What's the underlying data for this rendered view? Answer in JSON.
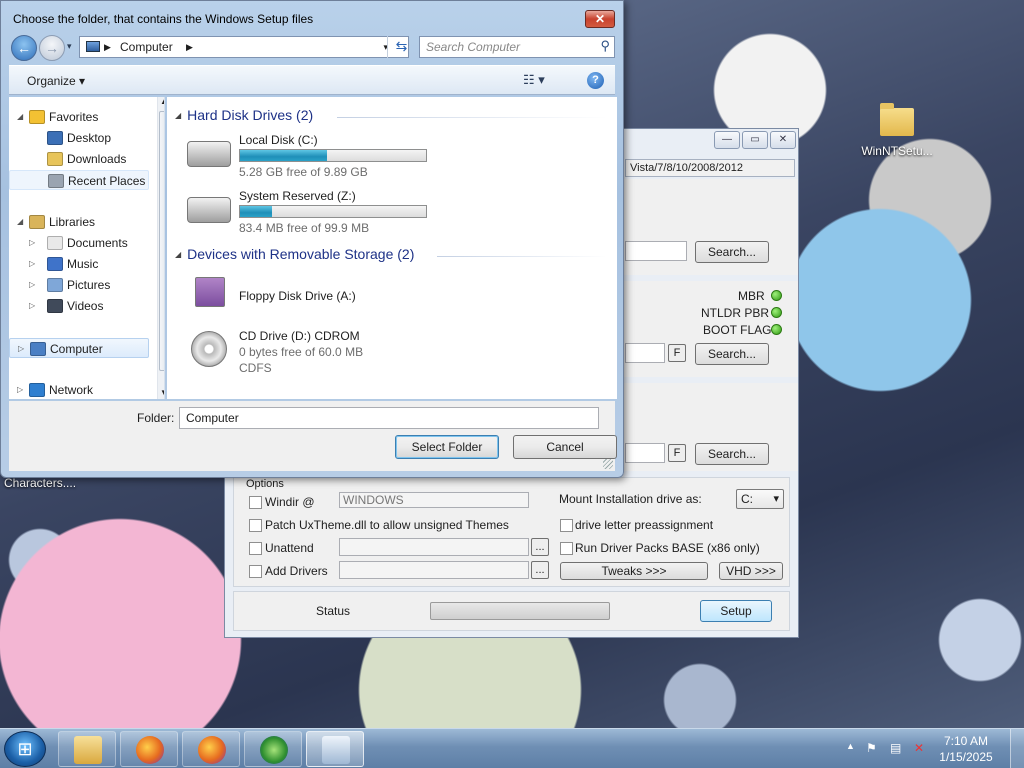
{
  "desktop": {
    "icon_label": "WinNTSetu...",
    "caption": "Characters...."
  },
  "app": {
    "tab_label": "Vista/7/8/10/2008/2012",
    "search_label": "Search...",
    "status_items": [
      {
        "label": "MBR",
        "color": "#3fb91c"
      },
      {
        "label": "NTLDR PBR",
        "color": "#3fb91c"
      },
      {
        "label": "BOOT FLAG",
        "color": "#3fb91c"
      }
    ],
    "f_label": "F",
    "options": {
      "group_label": "Options",
      "windir_label": "Windir @",
      "windir_value": "WINDOWS",
      "patch_label": "Patch UxTheme.dll to allow unsigned Themes",
      "unattend_label": "Unattend",
      "add_drivers_label": "Add Drivers",
      "browse_label": "...",
      "mount_label": "Mount Installation drive as:",
      "mount_value": "C:",
      "preassign_label": "drive letter preassignment",
      "driverpacks_label": "Run Driver Packs BASE (x86 only)",
      "tweaks_label": "Tweaks >>>",
      "vhd_label": "VHD >>>"
    },
    "status_label": "Status",
    "setup_label": "Setup",
    "window_buttons": {
      "min": "—",
      "max": "▭",
      "close": "✕"
    }
  },
  "dialog": {
    "title": "Choose the folder, that contains the Windows Setup files",
    "close": "✕",
    "address": "Computer",
    "search_placeholder": "Search Computer",
    "organize": "Organize ▾",
    "help": "?",
    "nav": [
      {
        "label": "Favorites",
        "icon": "star-icon",
        "color": "#f3c133",
        "indent": 0,
        "expander": "◢"
      },
      {
        "label": "Desktop",
        "icon": "desktop-icon",
        "color": "#3b6fb6",
        "indent": 1,
        "expander": ""
      },
      {
        "label": "Downloads",
        "icon": "downloads-folder-icon",
        "color": "#e7c45a",
        "indent": 1,
        "expander": ""
      },
      {
        "label": "Recent Places",
        "icon": "recent-places-icon",
        "color": "#9aa4b1",
        "indent": 1,
        "expander": ""
      },
      {
        "label": "Libraries",
        "icon": "libraries-icon",
        "color": "#d9b45a",
        "indent": 0,
        "expander": "◢"
      },
      {
        "label": "Documents",
        "icon": "documents-icon",
        "color": "#e9e9e9",
        "indent": 1,
        "expander": "▷"
      },
      {
        "label": "Music",
        "icon": "music-icon",
        "color": "#3f73c9",
        "indent": 1,
        "expander": "▷"
      },
      {
        "label": "Pictures",
        "icon": "pictures-icon",
        "color": "#7fa7d8",
        "indent": 1,
        "expander": "▷"
      },
      {
        "label": "Videos",
        "icon": "videos-icon",
        "color": "#404a5a",
        "indent": 1,
        "expander": "▷"
      },
      {
        "label": "Computer",
        "icon": "computer-icon",
        "color": "#4a7fc4",
        "indent": 0,
        "expander": "▷"
      },
      {
        "label": "Network",
        "icon": "network-icon",
        "color": "#2f7fd0",
        "indent": 0,
        "expander": "▷"
      }
    ],
    "groups": [
      {
        "title": "Hard Disk Drives (2)"
      },
      {
        "title": "Devices with Removable Storage (2)"
      }
    ],
    "drives": [
      {
        "name": "Local Disk (C:)",
        "sub": "5.28 GB free of 9.89 GB",
        "used_fraction": 0.47,
        "kind": "hdd"
      },
      {
        "name": "System Reserved (Z:)",
        "sub": "83.4 MB free of 99.9 MB",
        "used_fraction": 0.17,
        "kind": "hdd"
      },
      {
        "name": "Floppy Disk Drive (A:)",
        "sub": "",
        "kind": "floppy"
      },
      {
        "name": "CD Drive (D:) CDROM",
        "sub": "0 bytes free of 60.0 MB",
        "sub2": "CDFS",
        "kind": "cd"
      }
    ],
    "folder_label": "Folder:",
    "folder_value": "Computer",
    "select_label": "Select Folder",
    "cancel_label": "Cancel"
  },
  "taskbar": {
    "start_glyph": "⊞",
    "clock_time": "7:10 AM",
    "clock_date": "1/15/2025",
    "tray_arrow": "▲",
    "apps": [
      {
        "name": "explorer",
        "color": "#e8c560"
      },
      {
        "name": "firefox",
        "color": "#e66a1f"
      },
      {
        "name": "firefox-2",
        "color": "#e66a1f"
      },
      {
        "name": "installer",
        "color": "#3a9a3a"
      },
      {
        "name": "winntsetup",
        "color": "#9fb8d4"
      }
    ]
  }
}
